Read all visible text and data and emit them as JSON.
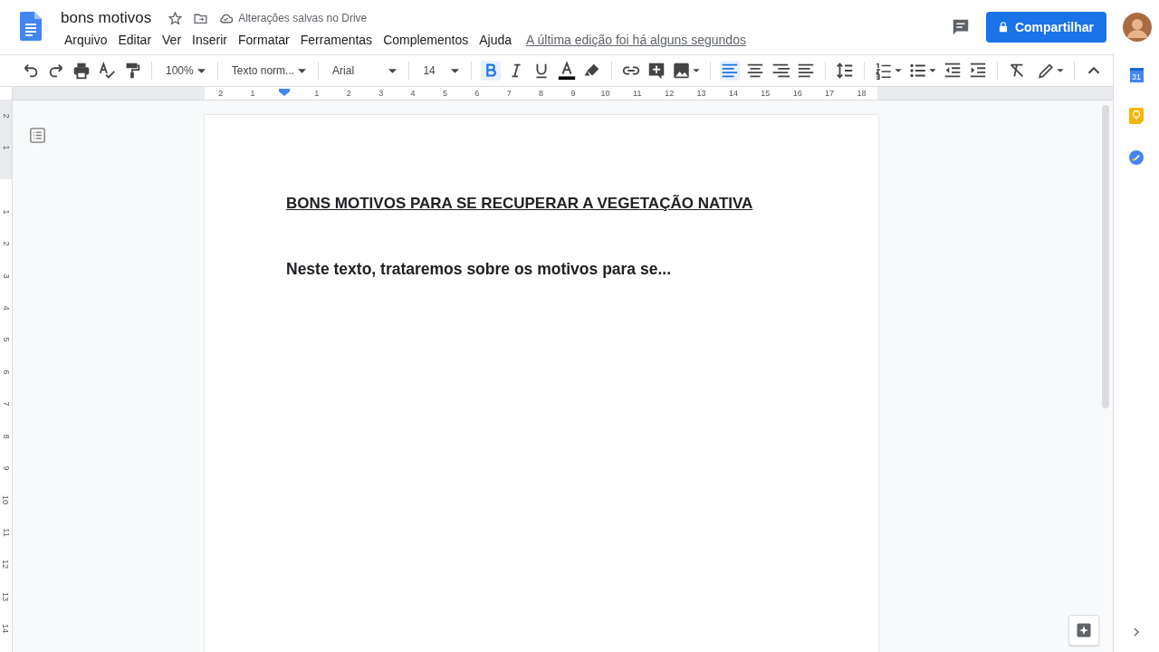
{
  "document": {
    "title": "bons motivos",
    "save_status": "Alterações salvas no Drive",
    "last_edit": "A última edição foi há alguns segundos"
  },
  "menu": [
    "Arquivo",
    "Editar",
    "Ver",
    "Inserir",
    "Formatar",
    "Ferramentas",
    "Complementos",
    "Ajuda"
  ],
  "share_button": "Compartilhar",
  "toolbar": {
    "zoom": "100%",
    "style": "Texto norm...",
    "font": "Arial",
    "size": "14",
    "format": [
      {
        "selected": true
      },
      {
        "selected": false
      },
      {
        "selected": false
      }
    ],
    "align": [
      {
        "selected": true
      },
      {
        "selected": false
      },
      {
        "selected": false
      },
      {
        "selected": false
      }
    ]
  },
  "ruler": {
    "left_labels": [
      "2",
      "1"
    ],
    "right_labels": [
      "1",
      "2",
      "3",
      "4",
      "5",
      "6",
      "7",
      "8",
      "9",
      "10",
      "11",
      "12",
      "13",
      "14",
      "15",
      "16",
      "17",
      "18"
    ]
  },
  "vertical_ruler": {
    "top_labels": [
      "2",
      "1"
    ],
    "labels": [
      "1",
      "2",
      "3",
      "4",
      "5",
      "6",
      "7",
      "8",
      "9",
      "10",
      "11",
      "12",
      "13",
      "14"
    ]
  },
  "page": {
    "heading": "BONS MOTIVOS PARA SE RECUPERAR A VEGETAÇÃO NATIVA",
    "paragraph": "Neste texto, trataremos sobre os motivos para se..."
  },
  "side_panel": {
    "calendar_day": "31"
  }
}
